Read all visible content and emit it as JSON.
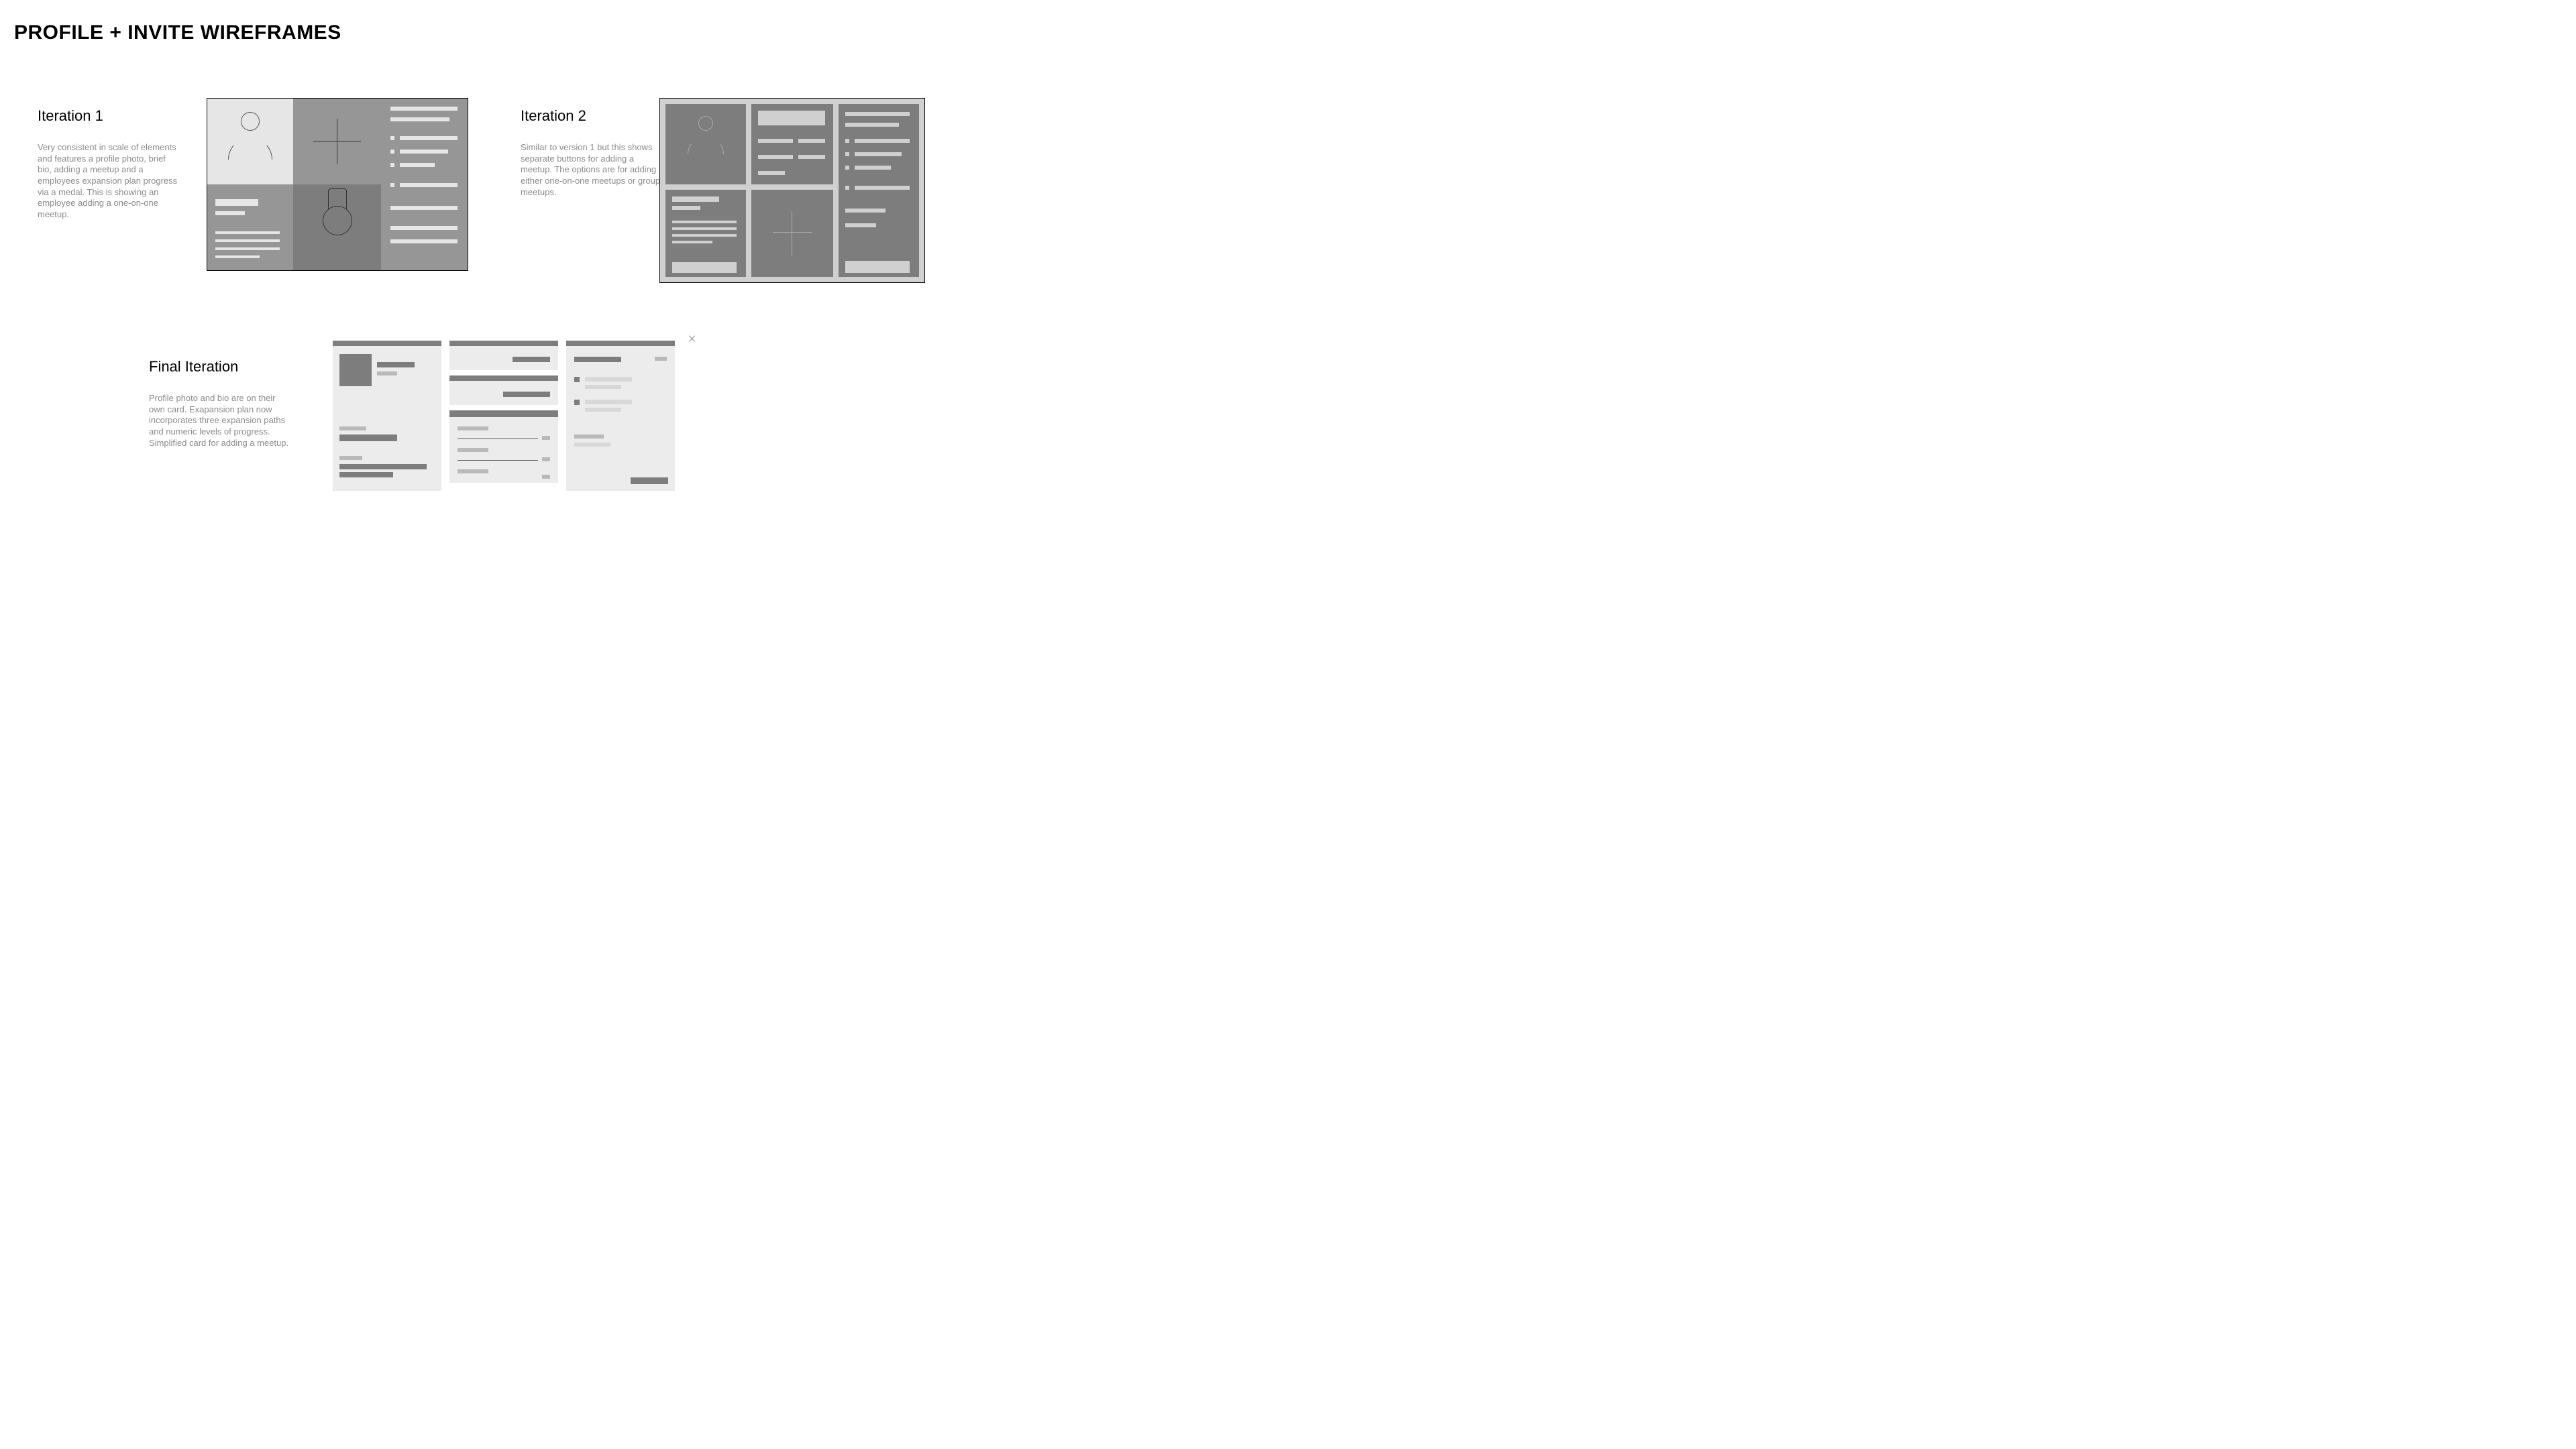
{
  "title": "PROFILE + INVITE WIREFRAMES",
  "iter1": {
    "heading": "Iteration 1",
    "body": "Very consistent in scale of elements and features a profile photo, brief bio, adding a meetup and a employees expansion plan progress via a medal. This is showing an employee adding a one-on-one meetup."
  },
  "iter2": {
    "heading": "Iteration 2",
    "body": "Similar to version 1 but this shows separate buttons for adding a meetup. The options are for adding either one-on-one meetups or group meetups."
  },
  "final": {
    "heading": "Final Iteration",
    "body": "Profile photo and bio are on their own card. Exapansion plan now incorporates three expan­sion paths and numeric levels of progress. Simplified card for adding a meetup."
  }
}
